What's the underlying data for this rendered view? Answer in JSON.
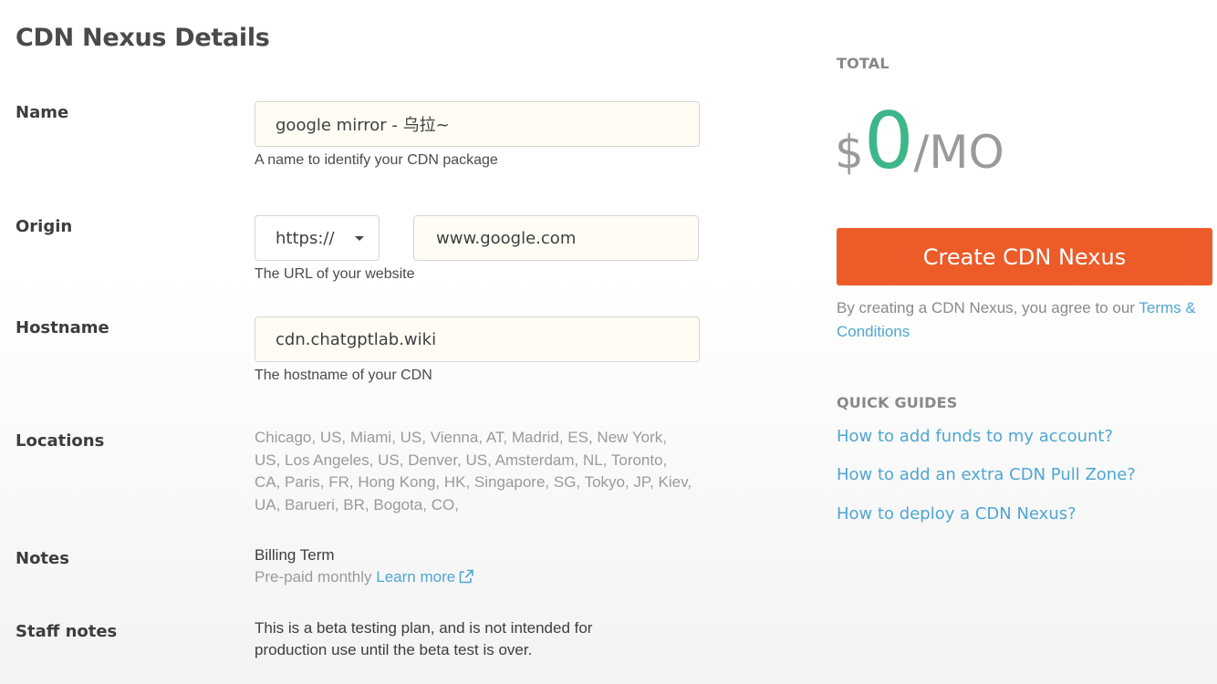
{
  "page": {
    "title": "CDN Nexus Details"
  },
  "form": {
    "name": {
      "label": "Name",
      "value": "google mirror - 乌拉~",
      "help": "A name to identify your CDN package"
    },
    "origin": {
      "label": "Origin",
      "protocol": "https://",
      "value": "www.google.com",
      "help": "The URL of your website"
    },
    "hostname": {
      "label": "Hostname",
      "value": "cdn.chatgptlab.wiki",
      "help": "The hostname of your CDN"
    },
    "locations": {
      "label": "Locations",
      "text": "Chicago, US, Miami, US, Vienna, AT, Madrid, ES, New York, US, Los Angeles, US, Denver, US, Amsterdam, NL, Toronto, CA, Paris, FR, Hong Kong, HK, Singapore, SG, Tokyo, JP, Kiev, UA, Barueri, BR, Bogota, CO,"
    },
    "notes": {
      "label": "Notes",
      "billing_term": "Billing Term",
      "plan": "Pre-paid monthly",
      "learn_more": "Learn more"
    },
    "staff_notes": {
      "label": "Staff notes",
      "line1": "This is a beta testing plan, and is not intended for",
      "line2": "production use until the beta test is over."
    }
  },
  "summary": {
    "total_label": "TOTAL",
    "currency": "$",
    "amount": "0",
    "period": "/MO",
    "create_button": "Create CDN Nexus",
    "agree_text": "By creating a CDN Nexus, you agree to our",
    "terms_link": "Terms & Conditions"
  },
  "quick_guides": {
    "label": "QUICK GUIDES",
    "links": [
      "How to add funds to my account?",
      "How to add an extra CDN Pull Zone?",
      "How to deploy a CDN Nexus?"
    ]
  },
  "colors": {
    "accent_orange": "#ec5b28",
    "price_green": "#3db689",
    "link_blue": "#4fa6d3"
  },
  "icons": {
    "protocol_dropdown": "caret-down-icon",
    "external_link": "external-link-icon"
  }
}
